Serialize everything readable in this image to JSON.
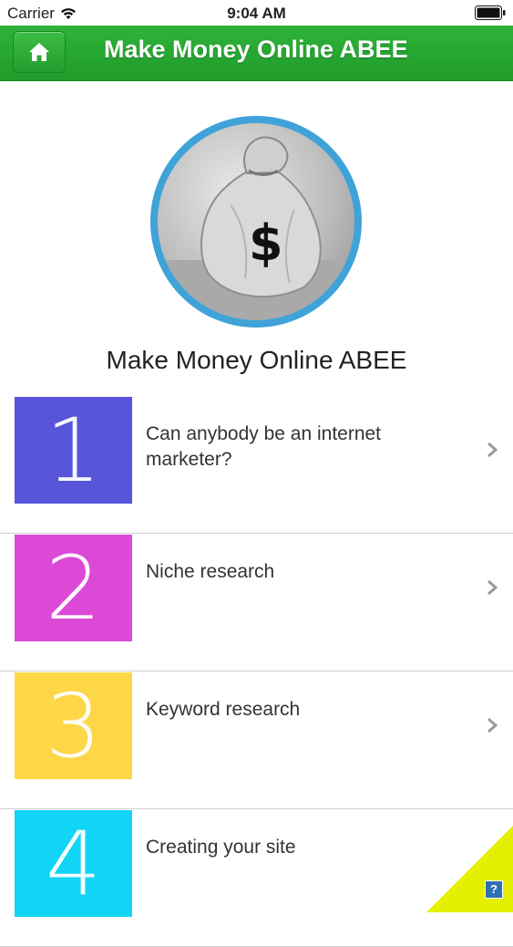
{
  "status_bar": {
    "carrier": "Carrier",
    "time": "9:04 AM"
  },
  "nav": {
    "title": "Make Money Online ABEE",
    "color": "#27a532"
  },
  "profile": {
    "title": "Make Money Online ABEE",
    "ring_color": "#3fa3d8"
  },
  "list": {
    "items": [
      {
        "number": "1",
        "label": "Can anybody be an internet marketer?",
        "color": "#5755d9"
      },
      {
        "number": "2",
        "label": "Niche research",
        "color": "#dc49d6"
      },
      {
        "number": "3",
        "label": "Keyword research",
        "color": "#fdd748"
      },
      {
        "number": "4",
        "label": "Creating your site",
        "color": "#12d5f5"
      }
    ]
  },
  "help": {
    "label": "?",
    "flap_color": "#e5f000"
  }
}
